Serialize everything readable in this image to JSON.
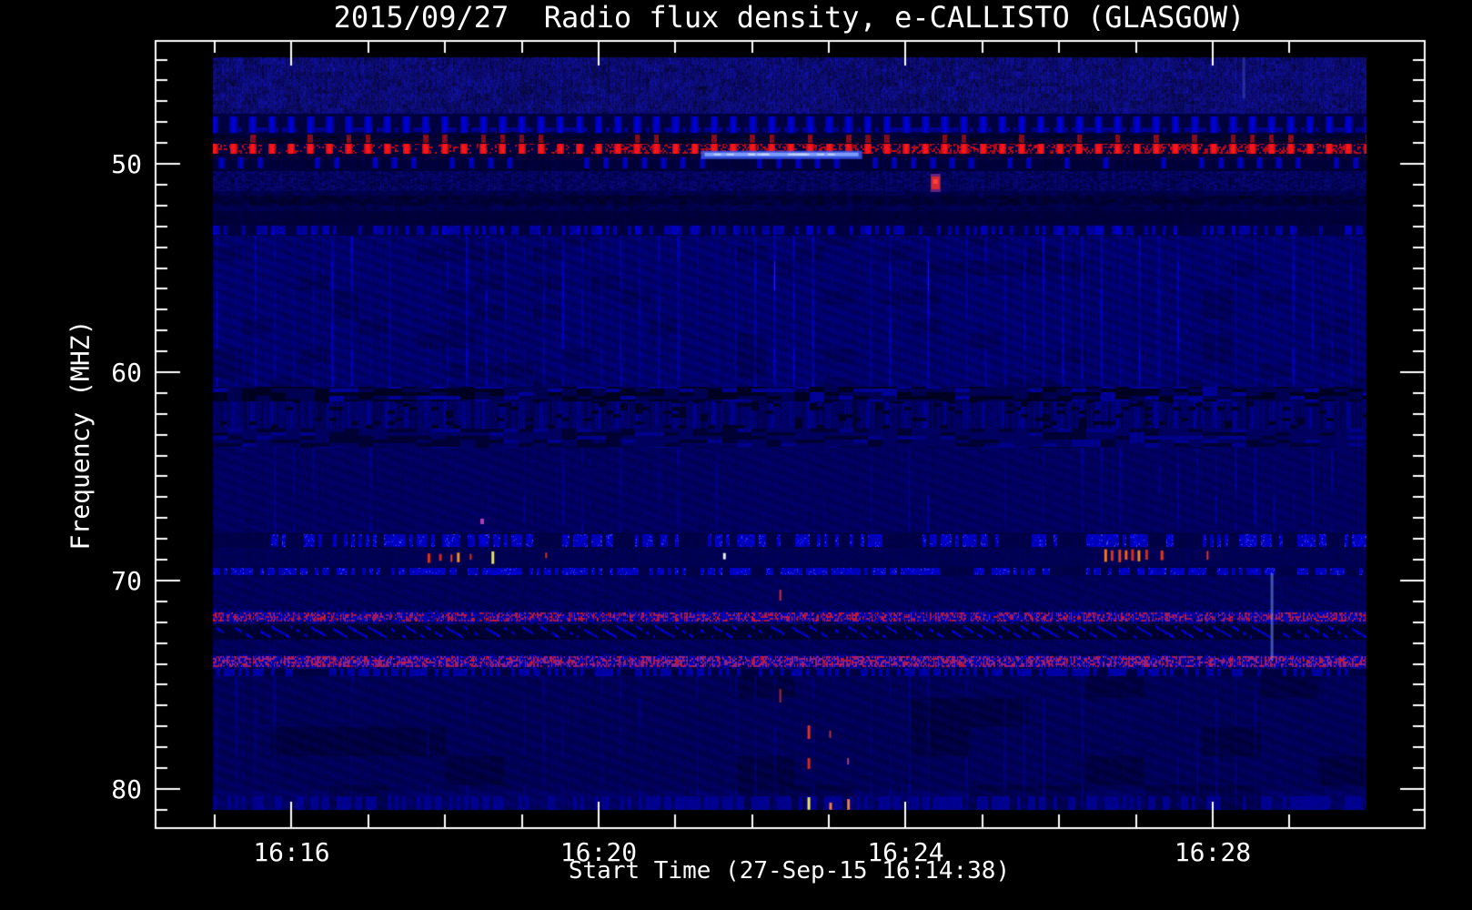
{
  "chart_data": {
    "type": "heatmap",
    "title": "2015/09/27  Radio flux density, e-CALLISTO (GLASGOW)",
    "date": "2015/09/27",
    "instrument": "e-CALLISTO",
    "station": "GLASGOW",
    "xlabel": "Start Time (27-Sep-15 16:14:38)",
    "ylabel": "Frequency (MHZ)",
    "x_axis": {
      "start": "16:14:13",
      "end": "16:30:45",
      "major_ticks": [
        {
          "label": "16:16",
          "time": "16:16:00"
        },
        {
          "label": "16:20",
          "time": "16:20:00"
        },
        {
          "label": "16:24",
          "time": "16:24:00"
        },
        {
          "label": "16:28",
          "time": "16:28:00"
        }
      ],
      "minor_tick_interval_s": 60,
      "first_minor": "16:15:00",
      "last_minor": "16:29:00"
    },
    "y_axis": {
      "unit": "MHz",
      "top_mhz": 44.06,
      "bottom_mhz": 81.88,
      "major_ticks": [
        {
          "label": "50",
          "mhz": 50
        },
        {
          "label": "60",
          "mhz": 60
        },
        {
          "label": "70",
          "mhz": 70
        },
        {
          "label": "80",
          "mhz": 80
        }
      ],
      "minor_tick_interval_mhz": 1,
      "first_minor_mhz": 45,
      "last_minor_mhz": 81
    },
    "image_extent": {
      "t_start": "16:14:58",
      "t_end": "16:30:00",
      "f_top_mhz": 44.9,
      "f_bottom_mhz": 81.0
    },
    "modulation": {
      "burst_period_s": 15,
      "description": "periodic broadband RFI bursts every 15 s"
    },
    "palette": {
      "background": "#000000",
      "frame": "#FFFFFF",
      "deep_blue": "#000060",
      "field_blue": "#0000A8",
      "bright_blue": "#4455E0",
      "streak_core": "#8FA8FF",
      "red": "#E02020",
      "bright_red": "#FF3020",
      "orange": "#F08030",
      "yellow": "#F0E860",
      "magenta": "#8A2890",
      "light_blue": "#7896F0"
    },
    "bands": [
      {
        "f0": 44.89,
        "f1": 47.6,
        "type": "top"
      },
      {
        "f0": 47.6,
        "f1": 48.6,
        "type": "blobrow"
      },
      {
        "f0": 48.6,
        "f1": 49.0,
        "type": "darkrow"
      },
      {
        "f0": 49.0,
        "f1": 49.56,
        "type": "redband"
      },
      {
        "f0": 49.56,
        "f1": 50.35,
        "type": "belowred"
      },
      {
        "f0": 50.35,
        "f1": 51.31,
        "type": "texmid"
      },
      {
        "f0": 51.31,
        "f1": 52.27,
        "type": "smudge"
      },
      {
        "f0": 52.27,
        "f1": 52.93,
        "type": "navy"
      },
      {
        "f0": 52.93,
        "f1": 53.45,
        "type": "dashrow"
      },
      {
        "f0": 53.45,
        "f1": 60.7,
        "type": "field"
      },
      {
        "f0": 60.7,
        "f1": 61.4,
        "type": "darkdash"
      },
      {
        "f0": 61.4,
        "f1": 62.71,
        "type": "striped"
      },
      {
        "f0": 62.71,
        "f1": 63.63,
        "type": "darkdash2"
      },
      {
        "f0": 63.63,
        "f1": 67.69,
        "type": "calm"
      },
      {
        "f0": 67.69,
        "f1": 68.43,
        "type": "bluedash"
      },
      {
        "f0": 68.43,
        "f1": 69.3,
        "type": "dotfield"
      },
      {
        "f0": 69.3,
        "f1": 69.78,
        "type": "bluedash"
      },
      {
        "f0": 69.78,
        "f1": 71.4,
        "type": "calm2"
      },
      {
        "f0": 71.4,
        "f1": 72.1,
        "type": "redmix"
      },
      {
        "f0": 72.1,
        "f1": 72.84,
        "type": "chevron"
      },
      {
        "f0": 72.84,
        "f1": 73.54,
        "type": "calm2"
      },
      {
        "f0": 73.54,
        "f1": 74.24,
        "type": "redmix2"
      },
      {
        "f0": 74.24,
        "f1": 74.59,
        "type": "bluedashrow"
      },
      {
        "f0": 74.59,
        "f1": 81.01,
        "type": "bottom"
      }
    ],
    "features": [
      {
        "type": "hstreak",
        "t0": "16:21:20",
        "t1": "16:23:26",
        "f": 49.55
      },
      {
        "type": "blob",
        "t": "16:24:23",
        "f0": 50.61,
        "f1": 51.22
      },
      {
        "type": "vline",
        "t": "16:28:46",
        "f0": 69.65,
        "f1": 73.84,
        "color": "rgba(120,150,245,0.55)",
        "w": 3
      },
      {
        "type": "vline",
        "t": "16:28:24",
        "f0": 44.89,
        "f1": 46.86,
        "color": "rgba(100,120,220,0.30)",
        "w": 3
      },
      {
        "type": "dash",
        "t": "16:22:44",
        "f0": 76.95,
        "f1": 77.6,
        "color": "#E03028",
        "w": 3
      },
      {
        "type": "dash",
        "t": "16:22:44",
        "f0": 78.52,
        "f1": 79.04,
        "color": "#D82820",
        "w": 3
      },
      {
        "type": "dash",
        "t": "16:22:44",
        "f0": 80.4,
        "f1": 81.0,
        "color": "#F0E860",
        "w": 3
      },
      {
        "type": "dash",
        "t": "16:23:01",
        "f0": 80.66,
        "f1": 81.0,
        "color": "#F08030",
        "w": 3
      },
      {
        "type": "dash",
        "t": "16:23:15",
        "f0": 80.49,
        "f1": 81.0,
        "color": "#F08030",
        "w": 3
      },
      {
        "type": "dash",
        "t": "16:23:01",
        "f0": 77.2,
        "f1": 77.55,
        "color": "rgba(220,60,60,0.8)",
        "w": 2
      },
      {
        "type": "dash",
        "t": "16:23:15",
        "f0": 78.52,
        "f1": 78.83,
        "color": "rgba(200,80,160,0.8)",
        "w": 2
      },
      {
        "type": "dash",
        "t": "16:22:22",
        "f0": 70.44,
        "f1": 70.96,
        "color": "rgba(230,50,50,0.9)",
        "w": 2
      },
      {
        "type": "dash",
        "t": "16:22:22",
        "f0": 75.2,
        "f1": 75.85,
        "color": "rgba(230,60,50,0.7)",
        "w": 2
      },
      {
        "type": "dot",
        "t": "16:18:29",
        "f": 67.16,
        "color": "#B03CB8",
        "w": 4,
        "h": 6
      },
      {
        "type": "dash",
        "t": "16:17:47",
        "f0": 68.7,
        "f1": 69.15,
        "color": "#E03020",
        "w": 3
      },
      {
        "type": "dash",
        "t": "16:17:56",
        "f0": 68.72,
        "f1": 69.05,
        "color": "#D02818",
        "w": 3
      },
      {
        "type": "dash",
        "t": "16:18:05",
        "f0": 68.75,
        "f1": 69.1,
        "color": "#E04820",
        "w": 2
      },
      {
        "type": "dash",
        "t": "16:18:10",
        "f0": 68.66,
        "f1": 69.12,
        "color": "#F09030",
        "w": 3
      },
      {
        "type": "dash",
        "t": "16:18:20",
        "f0": 68.72,
        "f1": 69.0,
        "color": "#D83020",
        "w": 2
      },
      {
        "type": "dash",
        "t": "16:18:37",
        "f0": 68.6,
        "f1": 69.2,
        "color": "#E8E070",
        "w": 3
      },
      {
        "type": "dash",
        "t": "16:19:19",
        "f0": 68.66,
        "f1": 68.92,
        "color": "#D03028",
        "w": 2
      },
      {
        "type": "dash",
        "t": "16:21:38",
        "f0": 68.68,
        "f1": 68.98,
        "color": "#F0F0F0",
        "w": 3
      },
      {
        "type": "dash",
        "t": "16:26:36",
        "f0": 68.5,
        "f1": 69.1,
        "color": "#F07828",
        "w": 3
      },
      {
        "type": "dash",
        "t": "16:26:41",
        "f0": 68.55,
        "f1": 69.05,
        "color": "#E03020",
        "w": 3
      },
      {
        "type": "dash",
        "t": "16:26:47",
        "f0": 68.52,
        "f1": 69.12,
        "color": "#E84020",
        "w": 3
      },
      {
        "type": "dash",
        "t": "16:26:52",
        "f0": 68.55,
        "f1": 69.0,
        "color": "#F06020",
        "w": 3
      },
      {
        "type": "dash",
        "t": "16:26:57",
        "f0": 68.5,
        "f1": 69.05,
        "color": "#E02818",
        "w": 3
      },
      {
        "type": "dash",
        "t": "16:27:02",
        "f0": 68.55,
        "f1": 69.08,
        "color": "#F08028",
        "w": 3
      },
      {
        "type": "dash",
        "t": "16:27:08",
        "f0": 68.52,
        "f1": 69.0,
        "color": "#D82818",
        "w": 3
      },
      {
        "type": "dash",
        "t": "16:27:20",
        "f0": 68.56,
        "f1": 69.02,
        "color": "#E03828",
        "w": 3
      },
      {
        "type": "dash",
        "t": "16:27:56",
        "f0": 68.58,
        "f1": 69.0,
        "color": "#E03028",
        "w": 2
      }
    ]
  }
}
